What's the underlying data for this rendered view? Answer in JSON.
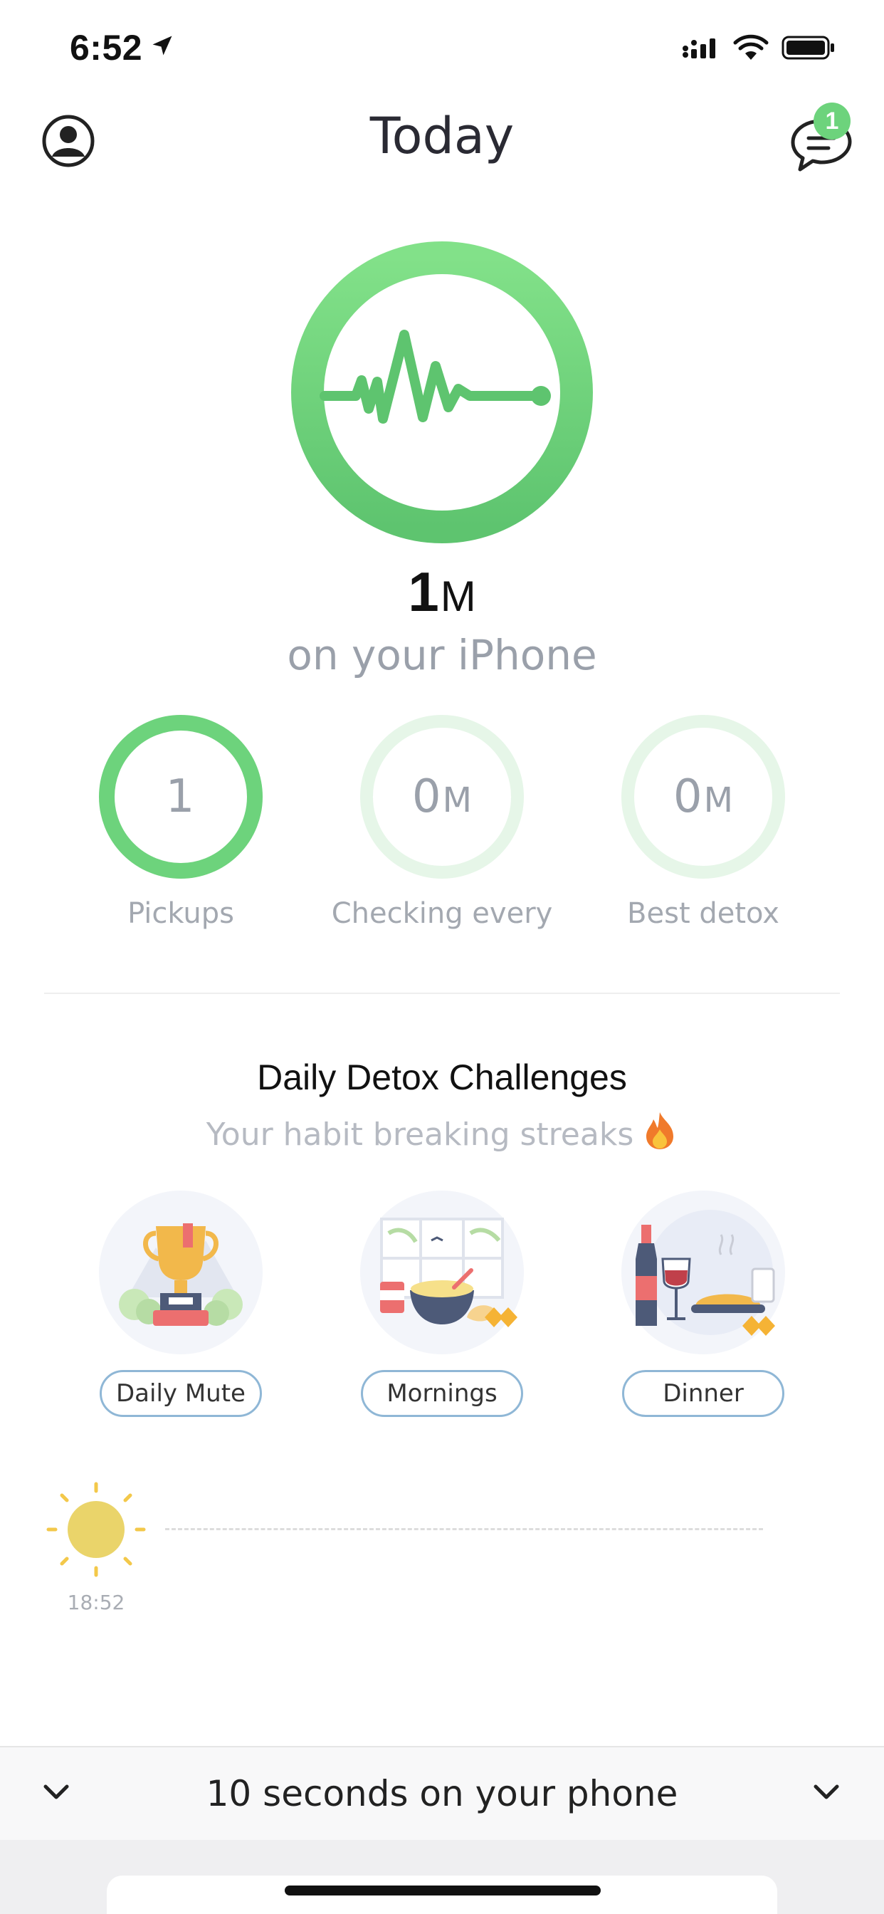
{
  "status_bar": {
    "time": "6:52"
  },
  "header": {
    "title": "Today",
    "message_badge": "1"
  },
  "summary": {
    "total_value": "1",
    "total_unit": "M",
    "subtitle": "on your iPhone"
  },
  "stats": [
    {
      "value": "1",
      "unit": "",
      "label": "Pickups"
    },
    {
      "value": "0",
      "unit": "M",
      "label": "Checking every"
    },
    {
      "value": "0",
      "unit": "M",
      "label": "Best detox"
    }
  ],
  "challenges": {
    "title": "Daily Detox Challenges",
    "subtitle": "Your habit breaking streaks",
    "items": [
      {
        "label": "Daily Mute"
      },
      {
        "label": "Mornings"
      },
      {
        "label": "Dinner"
      }
    ]
  },
  "timeline": {
    "sun_time": "18:52"
  },
  "bottom_bar": {
    "text": "10 seconds on your phone"
  },
  "colors": {
    "accent": "#6dd37c",
    "muted_text": "#9aa0aa",
    "button_border": "#8fb7d6"
  }
}
